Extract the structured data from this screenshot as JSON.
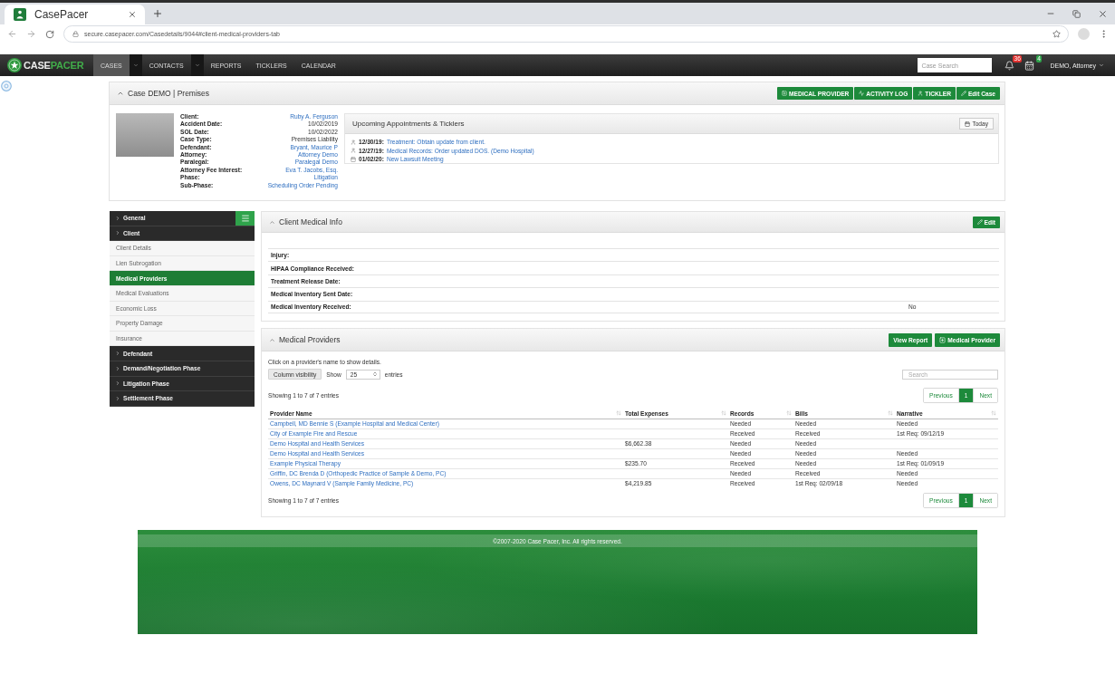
{
  "browser": {
    "tab_title": "CasePacer",
    "url": "secure.casepacer.com/Casedetails/9044#client-medical-providers-tab"
  },
  "navbar": {
    "logo": {
      "text": "CASE",
      "accent": "PACER"
    },
    "items": [
      {
        "label": "CASES",
        "selected": true,
        "dropdown": true
      },
      {
        "label": "CONTACTS",
        "selected": false,
        "dropdown": true
      },
      {
        "label": "REPORTS",
        "selected": false,
        "dropdown": false
      },
      {
        "label": "TICKLERS",
        "selected": false,
        "dropdown": false
      },
      {
        "label": "CALENDAR",
        "selected": false,
        "dropdown": false
      }
    ],
    "search": {
      "placeholder": "Case Search"
    },
    "notifications": {
      "count": "36"
    },
    "calendar": {
      "count": "4"
    },
    "user": "DEMO, Attorney"
  },
  "case": {
    "title": "Case DEMO | Premises",
    "actions": [
      {
        "label": "MEDICAL PROVIDER",
        "kind": "provider"
      },
      {
        "label": "ACTIVITY LOG",
        "kind": "log"
      },
      {
        "label": "TICKLER",
        "kind": "tickler"
      },
      {
        "label": "Edit Case",
        "kind": "edit"
      }
    ],
    "details": [
      {
        "label": "Client:",
        "value": "Ruby A. Ferguson",
        "link": true
      },
      {
        "label": "Accident Date:",
        "value": "10/02/2019",
        "link": false
      },
      {
        "label": "SOL Date:",
        "value": "10/02/2022",
        "link": false
      },
      {
        "label": "Case Type:",
        "value": "Premises Liability",
        "link": false
      },
      {
        "label": "Defendant:",
        "value": "Bryant, Maurice P",
        "link": true
      },
      {
        "label": "Attorney:",
        "value": "Attorney Demo",
        "link": true
      },
      {
        "label": "Paralegal:",
        "value": "Paralegal Demo",
        "link": true
      },
      {
        "label": "Attorney Fee Interest:",
        "value": "Eva T. Jacobs, Esq.",
        "link": true
      },
      {
        "label": "Phase:",
        "value": "Litigation",
        "link": true
      },
      {
        "label": "Sub-Phase:",
        "value": "Scheduling Order Pending",
        "link": true
      }
    ],
    "appointments": {
      "title": "Upcoming Appointments & Ticklers",
      "today": "Today",
      "items": [
        {
          "kind": "tickler",
          "date": "12/30/19:",
          "text": "Treatment: Obtain update from client."
        },
        {
          "kind": "tickler",
          "date": "12/27/19:",
          "text": "Medical Records: Order updated DOS. (Demo Hospital)"
        },
        {
          "kind": "appointment",
          "date": "01/02/20:",
          "text": "New Lawsuit Meeting"
        }
      ]
    }
  },
  "sidebar": {
    "sections": [
      {
        "label": "General"
      },
      {
        "label": "Client",
        "children": [
          {
            "label": "Client Details",
            "selected": false
          },
          {
            "label": "Lien Subrogation",
            "selected": false
          },
          {
            "label": "Medical Providers",
            "selected": true
          },
          {
            "label": "Medical Evaluations",
            "selected": false
          },
          {
            "label": "Economic Loss",
            "selected": false
          },
          {
            "label": "Property Damage",
            "selected": false
          },
          {
            "label": "Insurance",
            "selected": false
          }
        ]
      },
      {
        "label": "Defendant"
      },
      {
        "label": "Demand/Negotiation Phase"
      },
      {
        "label": "Litigation Phase"
      },
      {
        "label": "Settlement Phase"
      }
    ]
  },
  "client_medical_info": {
    "title": "Client Medical Info",
    "edit": "Edit",
    "fields": [
      {
        "label": "Injury:"
      },
      {
        "label": "HIPAA Compliance Received:"
      },
      {
        "label": "Treatment Release Date:"
      },
      {
        "label": "Medical Inventory Sent Date:"
      },
      {
        "label": "Medical Inventory Received:",
        "value": "No"
      }
    ]
  },
  "medical_providers": {
    "title": "Medical Providers",
    "buttons": [
      {
        "label": "View Report",
        "kind": "report"
      },
      {
        "label": "Medical Provider",
        "kind": "add"
      }
    ],
    "hint": "Click on a provider's name to show details.",
    "column_visibility": "Column visibility",
    "show_label": "Show",
    "page_size": "25",
    "entries_label": "entries",
    "search": {
      "placeholder": "Search"
    },
    "showing_top": "Showing 1 to 7 of 7 entries",
    "pagination_top": {
      "previous": "Previous",
      "pages": [
        {
          "label": "1",
          "selected": true
        }
      ],
      "next": "Next"
    },
    "table": {
      "columns": [
        "Provider Name",
        "Total Expenses",
        "Records",
        "Bills",
        "Narrative"
      ],
      "rows": [
        {
          "provider": "Campbell, MD Bennie S (Example Hospital and Medical Center)",
          "records": "Needed",
          "bills": "Needed",
          "narrative": "Needed"
        },
        {
          "provider": "City of Example Fire and Rescue",
          "records": "Received",
          "bills": "Received",
          "narrative": "1st Req: 09/12/19"
        },
        {
          "provider": "Demo Hospital and Health Services",
          "total_expenses": "$6,662.38",
          "records": "Needed",
          "bills": "Needed"
        },
        {
          "provider": "Demo Hospital and Health Services",
          "records": "Needed",
          "bills": "Needed",
          "narrative": "Needed"
        },
        {
          "provider": "Example Physical Therapy",
          "total_expenses": "$235.70",
          "records": "Received",
          "bills": "Needed",
          "narrative": "1st Req: 01/09/19"
        },
        {
          "provider": "Griffin, DC Brenda D (Orthopedic Practice of Sample & Demo, PC)",
          "records": "Needed",
          "bills": "Received",
          "narrative": "Needed"
        },
        {
          "provider": "Owens, DC Maynard V (Sample Family Medicine, PC)",
          "total_expenses": "$4,219.85",
          "records": "Received",
          "bills": "1st Req: 02/09/18",
          "narrative": "Needed"
        }
      ]
    },
    "showing_bottom": "Showing 1 to 7 of 7 entries",
    "pagination_bottom": {
      "previous": "Previous",
      "pages": [
        {
          "label": "1",
          "selected": true
        }
      ],
      "next": "Next"
    }
  },
  "footer": {
    "copyright": "©2007-2020 Case Pacer, Inc. All rights reserved."
  }
}
